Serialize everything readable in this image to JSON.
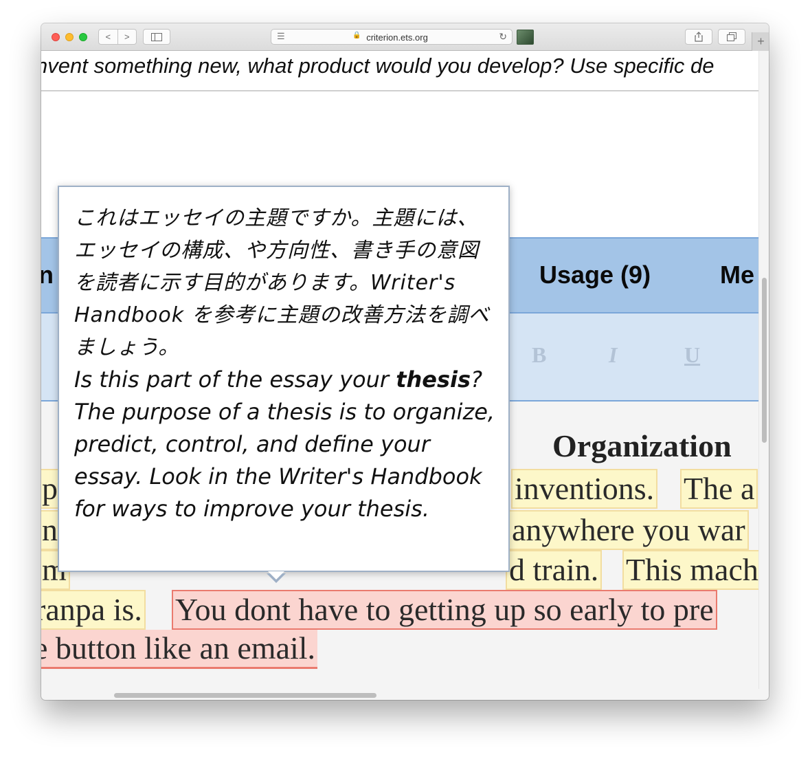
{
  "browser": {
    "url": "criterion.ets.org",
    "nav_back": "<",
    "nav_forward": ">",
    "new_tab": "+"
  },
  "page": {
    "prompt_text": "nvent something new, what product would you develop? Use specific de",
    "categories": {
      "left_partial": "n",
      "usage": "Usage (9)",
      "right_partial": "Me"
    },
    "format_toolbar": {
      "bold": "B",
      "italic": "I",
      "underline": "U"
    },
    "section_heading": "Organization",
    "essay_lines": {
      "line1_left": "p",
      "line1_mid": "inventions.",
      "line1_right": "The a",
      "line2_left": "n",
      "line2_right": "anywhere you war",
      "line3_left": "m",
      "line3_mid": "d train.",
      "line3_right": "This mach",
      "line4_left": "ranpa is.",
      "line4_right": "You dont have to getting up so early to pre",
      "line5": "e button like an email."
    }
  },
  "tooltip": {
    "jp_text": "これはエッセイの主題ですか。主題には、エッセイの構成、や方向性、書き手の意図を読者に示す目的があります。Writer's Handbook を参考に主題の改善方法を調べましょう。",
    "en_prefix": "Is this part of the essay your ",
    "en_bold": "thesis",
    "en_suffix": "? The purpose of a thesis is to organize, predict, control, and define your essay. Look in the Writer's Handbook for ways to improve your thesis."
  }
}
